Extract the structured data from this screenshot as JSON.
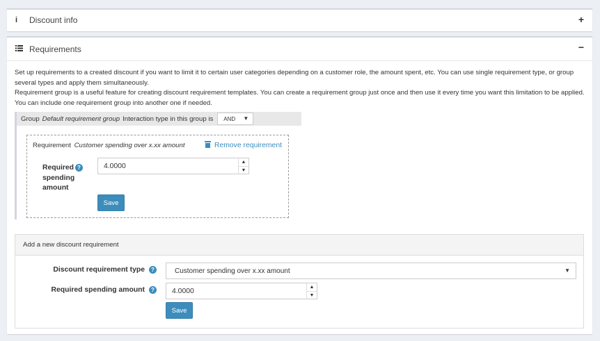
{
  "discount_info": {
    "icon": "info-icon",
    "title": "Discount info",
    "toggle": "+"
  },
  "requirements": {
    "icon": "list-icon",
    "title": "Requirements",
    "toggle": "−",
    "description_1": "Set up requirements to a created discount if you want to limit it to certain user categories depending on a customer role, the amount spent, etc. You can use single requirement type, or group several types and apply them simultaneously.",
    "description_2": "Requirement group is a useful feature for creating discount requirement templates. You can create a requirement group just once and then use it every time you want this limitation to be applied. You can include one requirement group into another one if needed.",
    "group": {
      "prefix": "Group",
      "name": "Default requirement group",
      "interaction_label": "Interaction type in this group is",
      "interaction_value": "AND"
    },
    "requirement": {
      "prefix": "Requirement",
      "name": "Customer spending over x.xx amount",
      "remove_label": "Remove requirement",
      "field_label": "Required spending amount",
      "field_value": "4.0000",
      "save_label": "Save"
    },
    "add_new": {
      "title": "Add a new discount requirement",
      "type_label": "Discount requirement type",
      "type_value": "Customer spending over x.xx amount",
      "amount_label": "Required spending amount",
      "amount_value": "4.0000",
      "save_label": "Save"
    }
  },
  "colors": {
    "accent": "#3c8dbc",
    "background": "#ecf0f5",
    "panel_border": "#d2d6de"
  }
}
